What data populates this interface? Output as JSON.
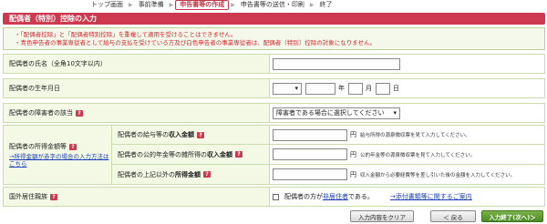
{
  "steps": [
    {
      "label": "トップ画面",
      "active": false
    },
    {
      "label": "事前準備",
      "active": false
    },
    {
      "label": "申告書等の作成",
      "active": true
    },
    {
      "label": "申告書等の送信・印刷",
      "active": false
    },
    {
      "label": "終了",
      "active": false
    }
  ],
  "title": "配偶者（特別）控除の入力",
  "notices": [
    "「配偶者控除」と「配偶者特別控除」を重複して適用を受けることはできません。",
    "青色申告者の事業専従者として給与の支払を受けている方及び白色申告者の事業専従者は、配偶者（特別）控除の対象になりません。"
  ],
  "form": {
    "name_label": "配偶者の氏名（全角10文字以内）",
    "name_value": "",
    "birth_label": "配偶者の生年月日",
    "birth_year_unit": "年",
    "birth_month_unit": "月",
    "birth_day_unit": "日",
    "disability_label": "配偶者の障害者の該当",
    "disability_select": "障害者である場合に選択してください",
    "income_label": "配偶者の所得金額等",
    "income_link": "→所得金額が赤字の場合の入力方法はこちら",
    "salary_label_pre": "配偶者の給与等の",
    "salary_label_bold": "収入金額",
    "salary_hint": "給与所得の源泉徴収票を見て入力してください。",
    "pension_label_pre": "配偶者の公的年金等の雑所得の",
    "pension_label_bold": "収入金額",
    "pension_hint": "公的年金等の源泉徴収票を見て入力してください。",
    "other_label_pre": "配偶者の上記以外の",
    "other_label_bold": "所得金額",
    "other_hint": "収入金額から必要経費等を差し引いた後の金額を入力してください。",
    "yen": "円",
    "overseas_label": "国外居住親族",
    "overseas_text_pre": "配偶者の方が",
    "overseas_text_link": "非居住者",
    "overseas_text_post": "である。",
    "overseas_doc_link": "→添付書類等に関するご案内"
  },
  "buttons": {
    "clear": "入力内容をクリア",
    "back": "＜ 戻る",
    "next": "入力終了(次へ)＞"
  }
}
